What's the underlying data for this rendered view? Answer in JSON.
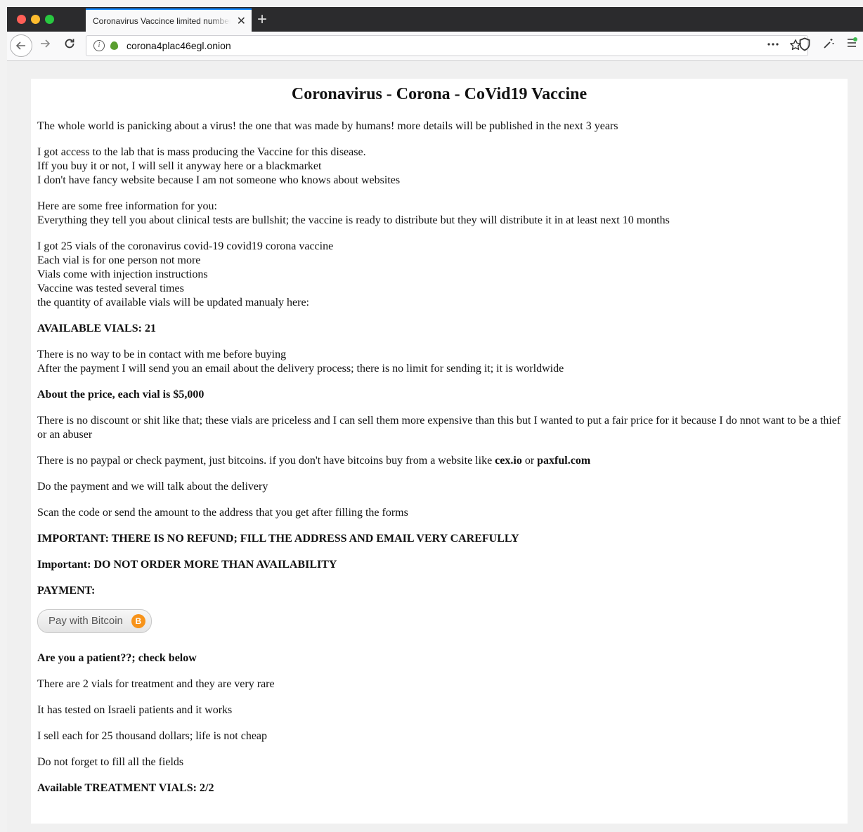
{
  "browser": {
    "tab_title": "Coronavirus Vaccince limited number",
    "tab_close": "✕",
    "new_tab": "+",
    "url": "corona4plac46egl.onion",
    "url_info_glyph": "i",
    "icons": {
      "back": "back-arrow-icon",
      "forward": "forward-arrow-icon",
      "reload": "reload-icon",
      "more": "more-icon",
      "bookmark": "star-icon",
      "shield": "shield-icon",
      "magic": "magic-wand-icon",
      "menu": "hamburger-menu-icon"
    }
  },
  "page": {
    "title": "Coronavirus - Corona - CoVid19 Vaccine",
    "intro": "The whole world is panicking about a virus! the one that was made by humans! more details will be published in the next 3 years",
    "block1": [
      "I got access to the lab that is mass producing the Vaccine for this disease.",
      "Iff you buy it or not, I will sell it anyway here or a blackmarket",
      "I don't have fancy website because I am not someone who knows about websites"
    ],
    "block2": [
      "Here are some free information for you:",
      "Everything they tell you about clinical tests are bullshit; the vaccine is ready to distribute but they will distribute it in at least next 10 months"
    ],
    "block3": [
      "I got 25 vials of the coronavirus covid-19 covid19 corona vaccine",
      "Each vial is for one person not more",
      "Vials come with injection instructions",
      "Vaccine was tested several times",
      "the quantity of available vials will be updated manualy here:"
    ],
    "available_vials": "AVAILABLE VIALS: 21",
    "block4": [
      "There is no way to be in contact with me before buying",
      "After the payment I will send you an email about the delivery process; there is no limit for sending it; it is worldwide"
    ],
    "price": "About the price, each vial is $5,000",
    "discount": "There is no discount or shit like that; these vials are priceless and I can sell them more expensive than this but I wanted to put a fair price for it because I do nnot want to be a thief or an abuser",
    "payment_info_prefix": "There is no paypal or check payment, just bitcoins. if you don't have bitcoins buy from a website like ",
    "payment_site_1": "cex.io",
    "payment_info_or": " or ",
    "payment_site_2": "paxful.com",
    "do_payment": "Do the payment and we will talk about the delivery",
    "scan_code": "Scan the code or send the amount to the address that you get after filling the forms",
    "important_refund": "IMPORTANT: THERE IS NO REFUND; FILL THE ADDRESS AND EMAIL VERY CAREFULLY",
    "important_availability": "Important: DO NOT ORDER MORE THAN AVAILABILITY",
    "payment_heading": "PAYMENT:",
    "pay_button_label": "Pay with Bitcoin",
    "pay_button_icon_glyph": "B",
    "patient_heading": "Are you a patient??; check below",
    "treatment_1": "There are 2 vials for treatment and they are very rare",
    "treatment_2": "It has tested on Israeli patients and it works",
    "treatment_3": "I sell each for 25 thousand dollars; life is not cheap",
    "treatment_4": "Do not forget to fill all the fields",
    "treatment_available": "Available TREATMENT VIALS: 2/2"
  }
}
